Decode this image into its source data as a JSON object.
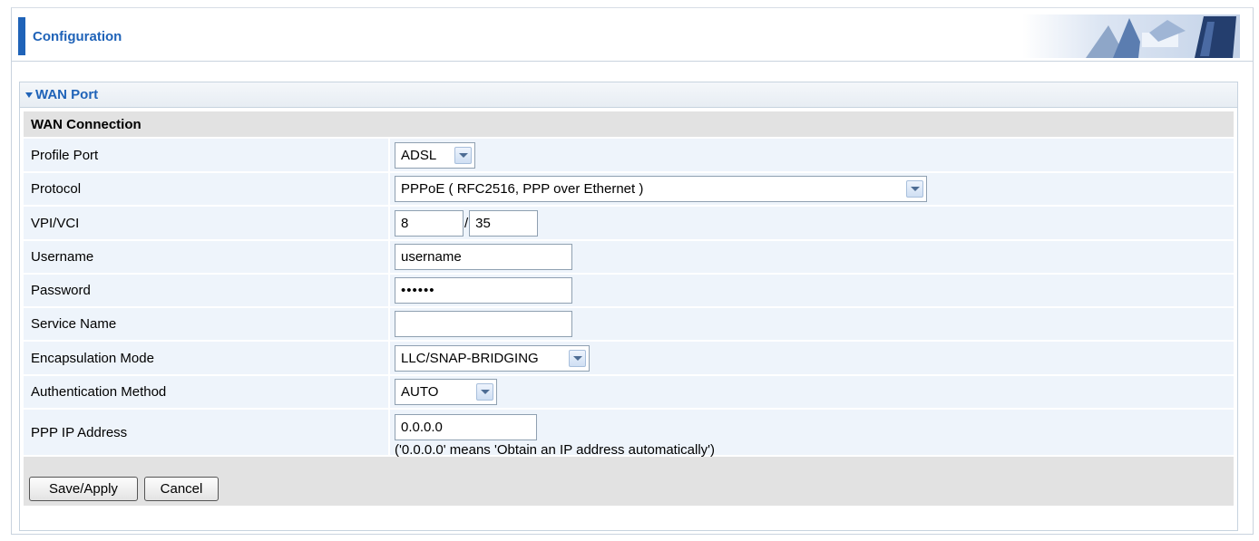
{
  "header": {
    "title": "Configuration"
  },
  "panel": {
    "title": "WAN Port"
  },
  "section": {
    "title": "WAN Connection"
  },
  "fields": {
    "profile_port": {
      "label": "Profile Port",
      "value": "ADSL"
    },
    "protocol": {
      "label": "Protocol",
      "value": "PPPoE ( RFC2516, PPP over Ethernet )"
    },
    "vpi_vci": {
      "label": "VPI/VCI",
      "vpi": "8",
      "separator": "/",
      "vci": "35"
    },
    "username": {
      "label": "Username",
      "value": "username"
    },
    "password": {
      "label": "Password",
      "value": "••••••"
    },
    "service_name": {
      "label": "Service Name",
      "value": ""
    },
    "encapsulation": {
      "label": "Encapsulation Mode",
      "value": "LLC/SNAP-BRIDGING"
    },
    "auth_method": {
      "label": "Authentication Method",
      "value": "AUTO"
    },
    "ppp_ip": {
      "label": "PPP IP Address",
      "value": "0.0.0.0",
      "note": "('0.0.0.0' means 'Obtain an IP address automatically')"
    }
  },
  "buttons": {
    "save": "Save/Apply",
    "cancel": "Cancel"
  },
  "colors": {
    "accent": "#1f63b8",
    "row_bg": "#eef4fb",
    "section_bg": "#e2e2e2"
  }
}
